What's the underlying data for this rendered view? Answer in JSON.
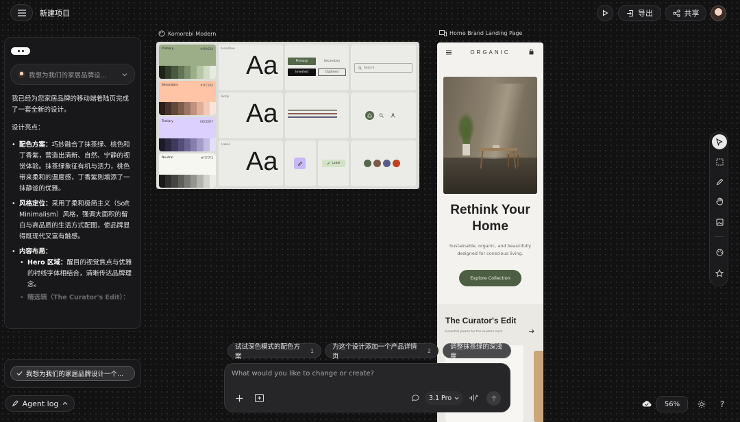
{
  "header": {
    "project_title": "新建项目",
    "export_label": "导出",
    "share_label": "共享"
  },
  "chat": {
    "user_message_preview": "我想为我们的家居品牌设...",
    "intro": "我已经为您家居品牌的移动端着陆页完成了一套全新的设计。",
    "highlights_heading": "设计亮点：",
    "items": [
      {
        "title": "配色方案：",
        "text": "巧妙融合了抹茶绿、桃色和丁香紫，营造出清新、自然、宁静的视觉体验。抹茶绿象征有机与活力，桃色带来柔和的温度感，丁香紫则增添了一抹静谧的优雅。"
      },
      {
        "title": "风格定位：",
        "text": "采用了柔和极简主义（Soft Minimalism）风格，强调大面积的留白与高品质的生活方式配图，使品牌显得既现代又富有触感。"
      },
      {
        "title": "内容布局：",
        "text": ""
      }
    ],
    "sub_items": [
      {
        "title": "Hero 区域：",
        "text": "醒目的视觉焦点与优雅的衬线字体相结合，清晰传达品牌理念。"
      },
      {
        "title": "精选辑（The Curator's Edit）：",
        "text": ""
      }
    ],
    "task_chip": "我想为我们的家居品牌设计一个...",
    "agent_log_label": "Agent log"
  },
  "design_system": {
    "frame_title": "Komorebi Modern",
    "swatches": [
      {
        "name": "Primary",
        "hex": "#9BAE88",
        "color": "#9bae88",
        "ramp": [
          "#1e2419",
          "#333d2b",
          "#4a5840",
          "#627456",
          "#7c906d",
          "#9bae88",
          "#b6c6a6",
          "#d0dcc4",
          "#e6ede0"
        ]
      },
      {
        "name": "Secondary",
        "hex": "#FFC3A5",
        "color": "#ffc3a5",
        "ramp": [
          "#2b1e17",
          "#45322a",
          "#62473b",
          "#7e5d4e",
          "#9d7565",
          "#c09080",
          "#dfae98",
          "#f3cab6",
          "#fbe4d8"
        ]
      },
      {
        "name": "Tertiary",
        "hex": "#DCD0FF",
        "color": "#dcd0ff",
        "ramp": [
          "#1c1a2a",
          "#2c2842",
          "#3e3a5c",
          "#524c78",
          "#6a6393",
          "#867fae",
          "#a39cc8",
          "#c3bce2",
          "#e3defa"
        ]
      },
      {
        "name": "Neutral",
        "hex": "#F7F7F2",
        "color": "#f7f7f2",
        "ramp": [
          "#1a1a19",
          "#2f2f2d",
          "#454543",
          "#5e5e5b",
          "#787874",
          "#95958f",
          "#b3b3ad",
          "#d2d2cc",
          "#ececE6"
        ]
      }
    ],
    "type_tiles": [
      {
        "label": "Headline",
        "sample": "Aa"
      },
      {
        "label": "Body",
        "sample": "Aa"
      },
      {
        "label": "Label",
        "sample": "Aa"
      }
    ],
    "buttons": {
      "primary": "Primary",
      "secondary": "Secondary",
      "inverted": "Inverted",
      "outlined": "Outlined"
    },
    "search_placeholder": "Search",
    "chip_label": "Label"
  },
  "landing": {
    "frame_title": "Home Brand Landing Page",
    "brand": "ORGANIC",
    "hero_title": "Rethink Your Home",
    "hero_subtitle": "Sustainable, organic, and beautifully designed for conscious living.",
    "cta": "Explore Collection",
    "section_title": "The Curator's Edit",
    "section_subtitle": "Essential pieces for the modern nest."
  },
  "suggestions": [
    {
      "text": "试试深色模式的配色方案",
      "num": "1"
    },
    {
      "text": "为这个设计添加一个产品详情页",
      "num": "2"
    },
    {
      "text": "调整抹茶绿的深浅度",
      "num": ""
    }
  ],
  "prompt": {
    "placeholder": "What would you like to change or create?",
    "model": "3.1 Pro"
  },
  "zoom": "56%",
  "help": "?"
}
